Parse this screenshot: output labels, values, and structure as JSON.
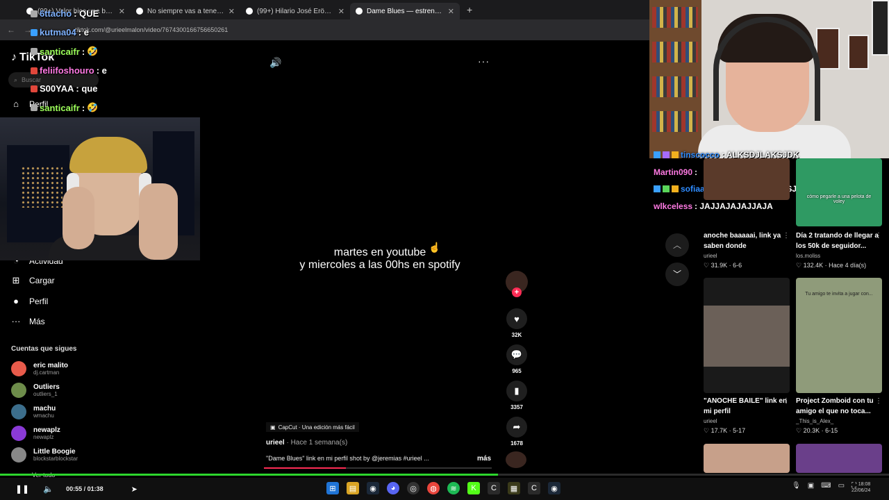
{
  "browser": {
    "tabs": [
      {
        "label": "(99+) Valor hice una bateria con",
        "active": false
      },
      {
        "label": "No siempre vas a tener a alguie",
        "active": false
      },
      {
        "label": "(99+) Hilario José Eröme: perfil",
        "active": false
      },
      {
        "label": "Dame Blues — estreno martes",
        "active": true
      }
    ],
    "url": "tiktok.com/@urieelmalon/video/7674300166756650261"
  },
  "tiktok": {
    "logo": "TikTok",
    "search_placeholder": "Buscar",
    "nav": [
      {
        "label": "Perfil",
        "icon": "home-icon"
      },
      {
        "label": "Actividad",
        "icon": "bell-icon"
      },
      {
        "label": "Cargar",
        "icon": "upload-icon"
      },
      {
        "label": "Perfil",
        "icon": "profile-icon"
      },
      {
        "label": "Más",
        "icon": "more-icon"
      }
    ],
    "following_title": "Cuentas que sigues",
    "following": [
      {
        "name": "eric malito",
        "handle": "dj.cartman",
        "color": "#e85b4b"
      },
      {
        "name": "Outliers",
        "handle": "outliers_1",
        "color": "#6d8c4a"
      },
      {
        "name": "machu",
        "handle": "wmachu",
        "color": "#3c6e8c"
      },
      {
        "name": "newaplz",
        "handle": "newaplz",
        "color": "#8a3ad6"
      },
      {
        "name": "Little Boogie",
        "handle": "blockstarblockstar",
        "color": "#888888"
      }
    ],
    "see_all": "Ver todo"
  },
  "chat_left": [
    {
      "user": "6ttacho",
      "msg": ": QUE",
      "color": "#7fb2ff"
    },
    {
      "user": "kutma04",
      "msg": ": e",
      "color": "#7fb2ff"
    },
    {
      "user": "santicaifr",
      "msg": ":",
      "color": "#9dff5a",
      "emoji": "🤣"
    },
    {
      "user": "feliifoshouro",
      "msg": ": e",
      "color": "#ff7ae3"
    },
    {
      "user": "S00YAA",
      "msg": ": que",
      "color": "#ffffff"
    },
    {
      "user": "santicaifr",
      "msg": ":",
      "color": "#9dff5a",
      "emoji": "🤣"
    }
  ],
  "chat_right": [
    {
      "user": "tinscocco",
      "msg": ": ALKSDJLAKSJDK",
      "color": "#2f8cff"
    },
    {
      "user": "Martin090",
      "msg": ":",
      "color": "#ff7ae3"
    },
    {
      "user": "sofiaarias02",
      "msg": ": UAJSKAJSKSJS",
      "color": "#2f8cff"
    },
    {
      "user": "wlkceless",
      "msg": ": JAJJAJAJAJJAJA",
      "color": "#ff7ae3"
    }
  ],
  "video": {
    "caption_line1": "martes en youtube",
    "caption_line2": "y miercoles a las 00hs en spotify",
    "capcut": "CapCut · Una edición más fácil",
    "author": "urieel",
    "posted": "· Hace 1 semana(s)",
    "description": "\"Dame Blues\" link en mi perfil shot by @jeremias #urieel ...",
    "more": "más",
    "progress": 0.36,
    "likes": "32K",
    "comments": "965",
    "saves": "3357",
    "shares": "1678"
  },
  "recommended": [
    {
      "title": "anoche baaaaai, link ya saben donde",
      "user": "urieel",
      "meta": "♡ 31.9K · 6-6",
      "thumb": "#5a3a2a",
      "overlay": ""
    },
    {
      "title": "Día 2 tratando de llegar a los 50k de seguidor...",
      "user": "los.moliss",
      "meta": "♡ 132.4K · Hace 4 día(s)",
      "thumb": "#2f9a63",
      "overlay": "cómo pegarle a una pelota de voley"
    },
    {
      "title": "\"ANOCHE BAILE\" link en mi perfil",
      "user": "urieel",
      "meta": "♡ 17.7K · 5-17",
      "thumb": "#6b6058",
      "overlay": ""
    },
    {
      "title": "Project Zomboid con tu amigo el que no toca...",
      "user": "_This_is_Alex_",
      "meta": "♡ 20.3K · 6-15",
      "thumb": "#8f9b7a",
      "overlay": "Tu amigo te invita a jugar con..."
    },
    {
      "title": "",
      "user": "",
      "meta": "",
      "thumb": "#c7a08a",
      "overlay": ""
    },
    {
      "title": "",
      "user": "",
      "meta": "",
      "thumb": "#6a3f8a",
      "overlay": ""
    }
  ],
  "player": {
    "time": "00:55 / 01:38",
    "progress": 0.56
  },
  "clock": {
    "time": "18:08",
    "date": "22/06/24"
  }
}
